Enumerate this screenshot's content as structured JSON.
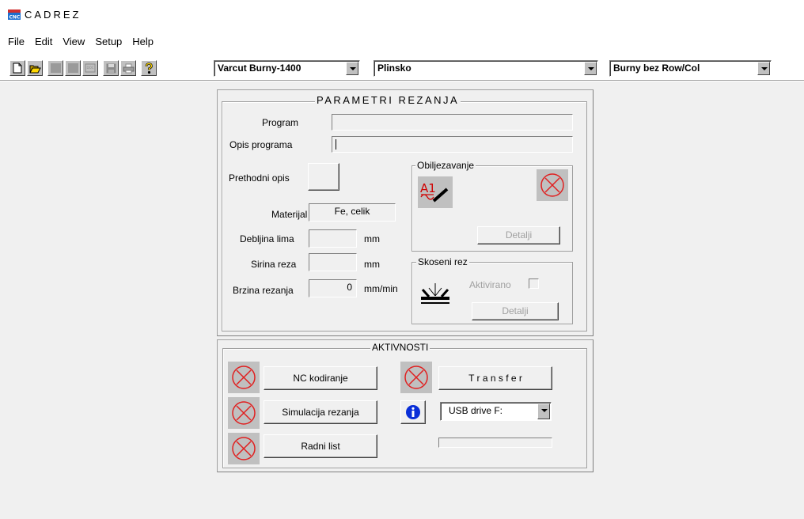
{
  "app": {
    "title": "CADREZ"
  },
  "menu": [
    "File",
    "Edit",
    "View",
    "Setup",
    "Help"
  ],
  "toolbar": {
    "icons": [
      "new-file-icon",
      "open-folder-icon",
      "disabled-icon",
      "disabled-icon",
      "disabled-icon",
      "save-icon",
      "print-icon",
      "help-icon"
    ],
    "machine": "Varcut Burny-1400",
    "process": "Plinsko",
    "controller": "Burny bez Row/Col"
  },
  "params": {
    "title": "PARAMETRI REZANJA",
    "program_label": "Program",
    "program_value": "",
    "opis_label": "Opis programa",
    "opis_value": "",
    "prethodni_label": "Prethodni opis",
    "materijal_label": "Materijal",
    "materijal_value": "Fe, celik",
    "debljina_label": "Debljina lima",
    "debljina_value": "",
    "debljina_unit": "mm",
    "sirina_label": "Sirina reza",
    "sirina_value": "",
    "sirina_unit": "mm",
    "brzina_label": "Brzina rezanja",
    "brzina_value": "0",
    "brzina_unit": "mm/min",
    "obiljezavanje": {
      "title": "Obiljezavanje",
      "detalji": "Detalji",
      "marker_text": "A1"
    },
    "skoseni": {
      "title": "Skoseni rez",
      "aktivirano": "Aktivirano",
      "detalji": "Detalji"
    }
  },
  "aktivnosti": {
    "title": "AKTIVNOSTI",
    "nc": "NC kodiranje",
    "simulacija": "Simulacija rezanja",
    "radni": "Radni list",
    "transfer": "T r a n s f e r",
    "drive": "USB drive F:"
  },
  "colors": {
    "x_red": "#e02020",
    "info_blue": "#0a2fd8",
    "disabled_grey": "#a0a0a0"
  }
}
